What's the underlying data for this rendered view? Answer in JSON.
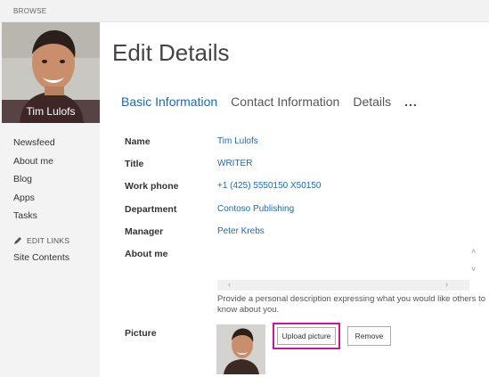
{
  "ribbon": {
    "tab": "BROWSE"
  },
  "profile": {
    "name": "Tim Lulofs"
  },
  "nav": {
    "items": [
      {
        "label": "Newsfeed"
      },
      {
        "label": "About me"
      },
      {
        "label": "Blog"
      },
      {
        "label": "Apps"
      },
      {
        "label": "Tasks"
      }
    ],
    "edit_links": "EDIT LINKS",
    "site_contents": "Site Contents"
  },
  "page": {
    "title": "Edit Details"
  },
  "tabs": [
    {
      "label": "Basic Information",
      "active": true
    },
    {
      "label": "Contact Information",
      "active": false
    },
    {
      "label": "Details",
      "active": false
    }
  ],
  "tabs_more": "...",
  "fields": [
    {
      "label": "Name",
      "value": "Tim Lulofs"
    },
    {
      "label": "Title",
      "value": "WRITER"
    },
    {
      "label": "Work phone",
      "value": "+1 (425) 5550150  X50150"
    },
    {
      "label": "Department",
      "value": "Contoso Publishing"
    },
    {
      "label": "Manager",
      "value": "Peter Krebs"
    },
    {
      "label": "About me",
      "value": ""
    }
  ],
  "about_help": "Provide a personal description expressing what you would like others to know about you.",
  "picture": {
    "label": "Picture",
    "upload_label": "Upload picture",
    "remove_label": "Remove"
  },
  "colors": {
    "link": "#1a6bb0",
    "highlight": "#c8189a",
    "nav_bg": "#f3f3f3"
  }
}
